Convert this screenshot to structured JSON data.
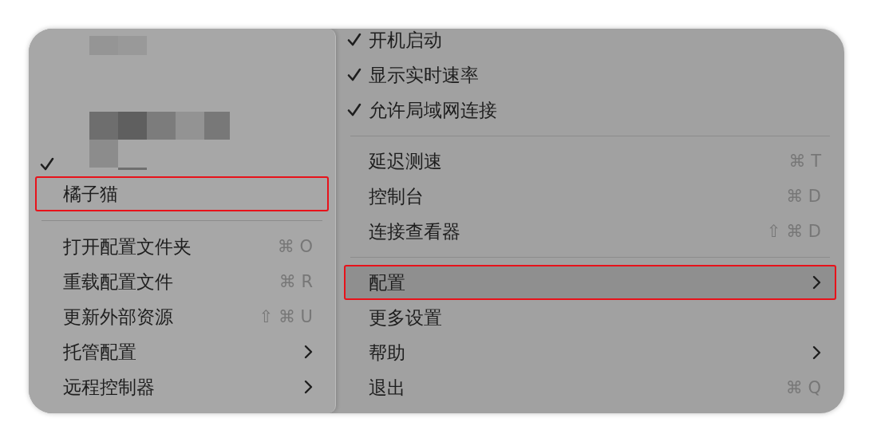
{
  "left_menu": {
    "items": [
      {
        "kind": "redacted",
        "checked": true
      },
      {
        "kind": "item",
        "label": "橘子猫",
        "annotated": true,
        "selected": false
      },
      {
        "kind": "separator"
      },
      {
        "kind": "item",
        "label": "打开配置文件夹",
        "shortcut": "⌘ O",
        "selected": false
      },
      {
        "kind": "item",
        "label": "重载配置文件",
        "shortcut": "⌘ R",
        "selected": false
      },
      {
        "kind": "item",
        "label": "更新外部资源",
        "shortcut": "⇧ ⌘ U",
        "selected": false
      },
      {
        "kind": "submenu",
        "label": "托管配置",
        "selected": false
      },
      {
        "kind": "submenu",
        "label": "远程控制器",
        "selected": false
      }
    ]
  },
  "right_menu": {
    "items": [
      {
        "kind": "check",
        "label": "开机启动",
        "checked": true
      },
      {
        "kind": "check",
        "label": "显示实时速率",
        "checked": true
      },
      {
        "kind": "check",
        "label": "允许局域网连接",
        "checked": true
      },
      {
        "kind": "separator"
      },
      {
        "kind": "item",
        "label": "延迟测速",
        "shortcut": "⌘ T",
        "selected": false
      },
      {
        "kind": "item",
        "label": "控制台",
        "shortcut": "⌘ D",
        "selected": false
      },
      {
        "kind": "item",
        "label": "连接查看器",
        "shortcut": "⇧ ⌘ D",
        "selected": false
      },
      {
        "kind": "separator"
      },
      {
        "kind": "submenu",
        "label": "配置",
        "selected": true,
        "annotated": true
      },
      {
        "kind": "item",
        "label": "更多设置",
        "selected": false
      },
      {
        "kind": "submenu",
        "label": "帮助",
        "selected": false
      },
      {
        "kind": "item",
        "label": "退出",
        "shortcut": "⌘ Q",
        "selected": false
      }
    ]
  }
}
